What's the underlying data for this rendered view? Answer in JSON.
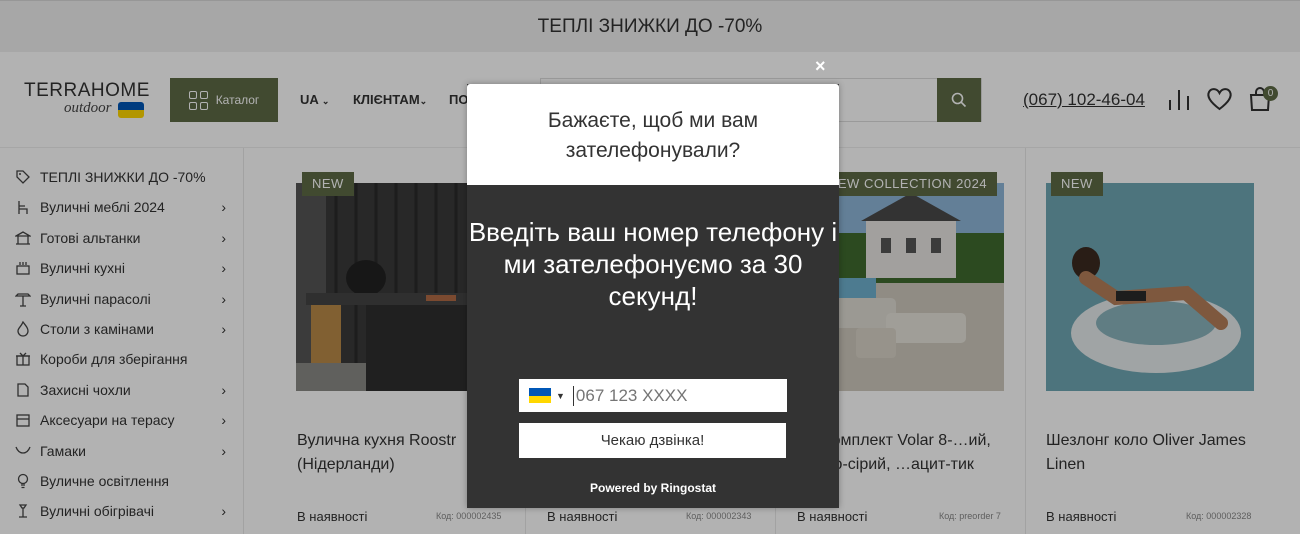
{
  "promo_bar": {
    "text": "ТЕПЛІ ЗНИЖКИ ДО -70%"
  },
  "header": {
    "logo_main": "TERRAHOME",
    "logo_sub": "outdoor",
    "catalog_label": "Каталог",
    "nav": [
      {
        "label": "UA"
      },
      {
        "label": "КЛІЄНТАМ"
      },
      {
        "label": "ПО"
      }
    ],
    "phone": "(067) 102-46-04",
    "cart_count": "0"
  },
  "colors": {
    "brand": "#5d6b46",
    "flag_blue": "#0057b7",
    "flag_yellow": "#ffd700"
  },
  "sidebar": {
    "items": [
      {
        "label": "ТЕПЛІ ЗНИЖКИ ДО -70%",
        "icon": "tag-icon",
        "has_children": false
      },
      {
        "label": "Вуличні меблі 2024",
        "icon": "chair-icon",
        "has_children": true
      },
      {
        "label": "Готові альтанки",
        "icon": "gazebo-icon",
        "has_children": true
      },
      {
        "label": "Вуличні кухні",
        "icon": "kitchen-icon",
        "has_children": true
      },
      {
        "label": "Вуличні парасолі",
        "icon": "umbrella-icon",
        "has_children": true
      },
      {
        "label": "Столи з камінами",
        "icon": "fire-icon",
        "has_children": true
      },
      {
        "label": "Короби для зберігання",
        "icon": "box-icon",
        "has_children": false
      },
      {
        "label": "Захисні чохли",
        "icon": "cover-icon",
        "has_children": true
      },
      {
        "label": "Аксесуари на терасу",
        "icon": "accessory-icon",
        "has_children": true
      },
      {
        "label": "Гамаки",
        "icon": "hammock-icon",
        "has_children": true
      },
      {
        "label": "Вуличне освітлення",
        "icon": "bulb-icon",
        "has_children": false
      },
      {
        "label": "Вуличні обігрівачі",
        "icon": "heater-icon",
        "has_children": true
      }
    ]
  },
  "products": [
    {
      "tag": "NEW",
      "title": "Вулична кухня Roostr (Нідерланди)",
      "availability": "В наявності",
      "code": "Код: 000002435"
    },
    {
      "tag": "",
      "title": "",
      "availability": "В наявності",
      "code": "Код: 000002343"
    },
    {
      "tag": "NEW COLLECTION 2024",
      "title": "…к комплект Volar 8-…ий, світло-сірий, …ацит-тик",
      "availability": "В наявності",
      "code": "Код: preorder 7"
    },
    {
      "tag": "NEW",
      "title": "Шезлонг коло Oliver James Linen",
      "availability": "В наявності",
      "code": "Код: 000002328"
    }
  ],
  "modal": {
    "close_label": "×",
    "header_text": "Бажаєте, щоб ми вам зателефонували?",
    "main_text": "Введіть ваш номер телефону і ми зателефонуємо за 30 секунд!",
    "phone_placeholder": "067 123 XXXX",
    "button_label": "Чекаю дзвінка!",
    "powered_by": "Powered by Ringostat"
  }
}
